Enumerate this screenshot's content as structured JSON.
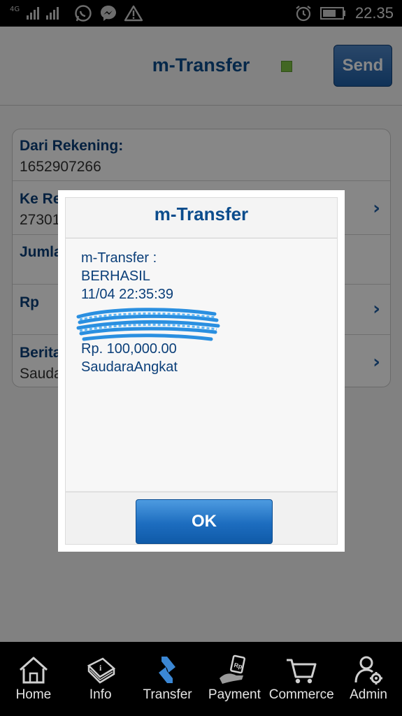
{
  "status_bar": {
    "network": "4G",
    "time": "22.35"
  },
  "header": {
    "title": "m-Transfer",
    "send_label": "Send"
  },
  "form": {
    "rows": [
      {
        "label": "Dari Rekening:",
        "value": "1652907266"
      },
      {
        "label": "Ke Re",
        "value": "27301"
      },
      {
        "label": "Jumla",
        "value": ""
      },
      {
        "label": "Rp",
        "value": ""
      },
      {
        "label": "Berita",
        "value": "Sauda"
      }
    ]
  },
  "dialog": {
    "title": "m-Transfer",
    "lines": [
      "m-Transfer :",
      "BERHASIL",
      "11/04 22:35:39",
      "Rp. 100,000.00",
      "SaudaraAngkat"
    ],
    "ok_label": "OK"
  },
  "bottom_nav": {
    "items": [
      {
        "label": "Home",
        "icon": "home-icon"
      },
      {
        "label": "Info",
        "icon": "info-book-icon"
      },
      {
        "label": "Transfer",
        "icon": "transfer-arrows-icon"
      },
      {
        "label": "Payment",
        "icon": "payment-hand-icon"
      },
      {
        "label": "Commerce",
        "icon": "cart-icon"
      },
      {
        "label": "Admin",
        "icon": "user-settings-icon"
      }
    ]
  },
  "colors": {
    "primary_blue": "#0b4c8c",
    "button_blue": "#1d6dbf",
    "status_led": "#7dc242"
  }
}
